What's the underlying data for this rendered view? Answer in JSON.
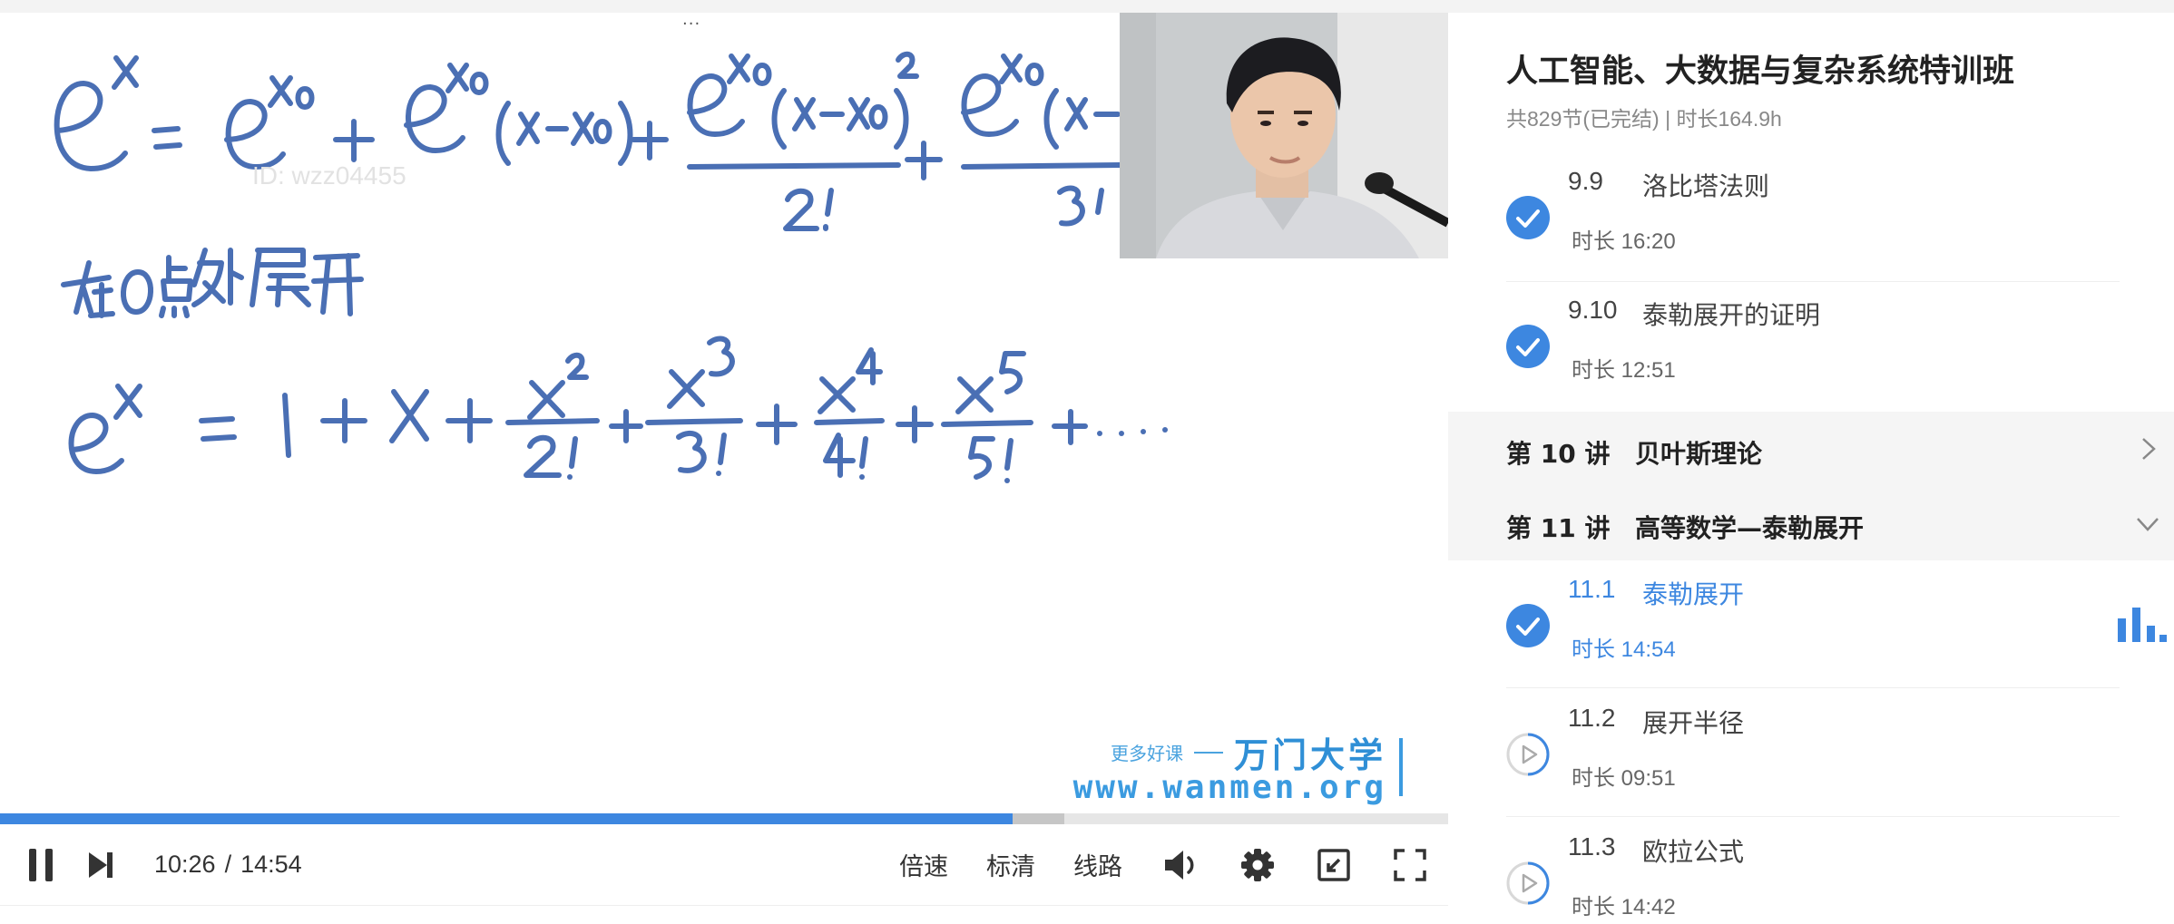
{
  "player": {
    "watermark_id": "ID: wzz04455",
    "more_dots": "···",
    "brand_small": "更多好课",
    "brand_name": "万门大学",
    "brand_url": "www.wanmen.org",
    "time_current": "10:26",
    "time_separator": "/",
    "time_total": "14:54",
    "progress_played": 0.699,
    "progress_buffered": 0.735,
    "speed_label": "倍速",
    "quality_label": "标清",
    "route_label": "线路",
    "accent_color": "#3d87e0"
  },
  "sidebar": {
    "course_title": "人工智能、大数据与复杂系统特训班",
    "course_meta": "共829节(已完结) | 时长164.9h",
    "duration_prefix": "时长",
    "lessons_before": [
      {
        "num": "9.9",
        "name": "洛比塔法则",
        "duration": "时长 16:20",
        "done": true
      },
      {
        "num": "9.10",
        "name": "泰勒展开的证明",
        "duration": "时长 12:51",
        "done": true
      }
    ],
    "section_10": {
      "label": "第 10 讲",
      "title": "贝叶斯理论",
      "expanded": false
    },
    "section_11": {
      "label": "第 11 讲",
      "title": "高等数学—泰勒展开",
      "expanded": true
    },
    "lessons_after": [
      {
        "num": "11.1",
        "name": "泰勒展开",
        "duration": "时长 14:54",
        "done": true,
        "active": true
      },
      {
        "num": "11.2",
        "name": "展开半径",
        "duration": "时长 09:51",
        "done": false
      },
      {
        "num": "11.3",
        "name": "欧拉公式",
        "duration": "时长 14:42",
        "done": false
      }
    ]
  }
}
